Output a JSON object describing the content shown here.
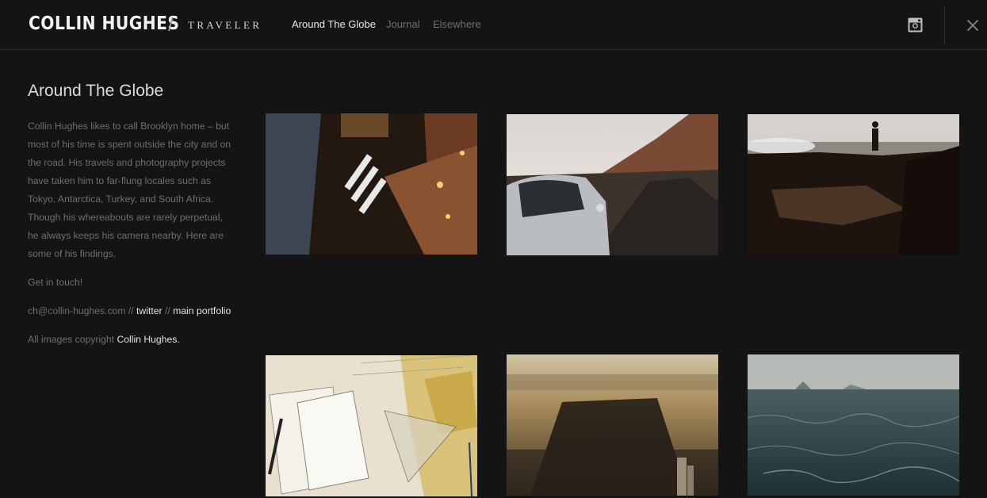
{
  "header": {
    "brand": "COLLIN HUGHES",
    "separator": "/",
    "subtitle": "TRAVELER",
    "nav": [
      "Around The Globe",
      "Journal",
      "Elsewhere"
    ]
  },
  "sidebar": {
    "title": "Around The Globe",
    "bio": "Collin Hughes likes to call Brooklyn home – but most of his time is spent outside the city and on the road. His travels and photography projects have taken him to far-flung locales such as Tokyo, Antarctica, Turkey, and South Africa. Though his whereabouts are rarely perpetual, he always keeps his camera nearby. Here are some of his findings.",
    "contact_prompt": "Get in touch!",
    "email": "ch@collin-hughes.com",
    "link_sep": "//",
    "twitter": "twitter",
    "portfolio": "main portfolio",
    "copyright_prefix": "All images copyright",
    "copyright_name": "Collin Hughes."
  },
  "colors": {
    "background": "#141414",
    "text_muted": "#6e6e6e",
    "text_bright": "#e2e2e2"
  },
  "icons": [
    "instagram-icon",
    "close-icon"
  ]
}
